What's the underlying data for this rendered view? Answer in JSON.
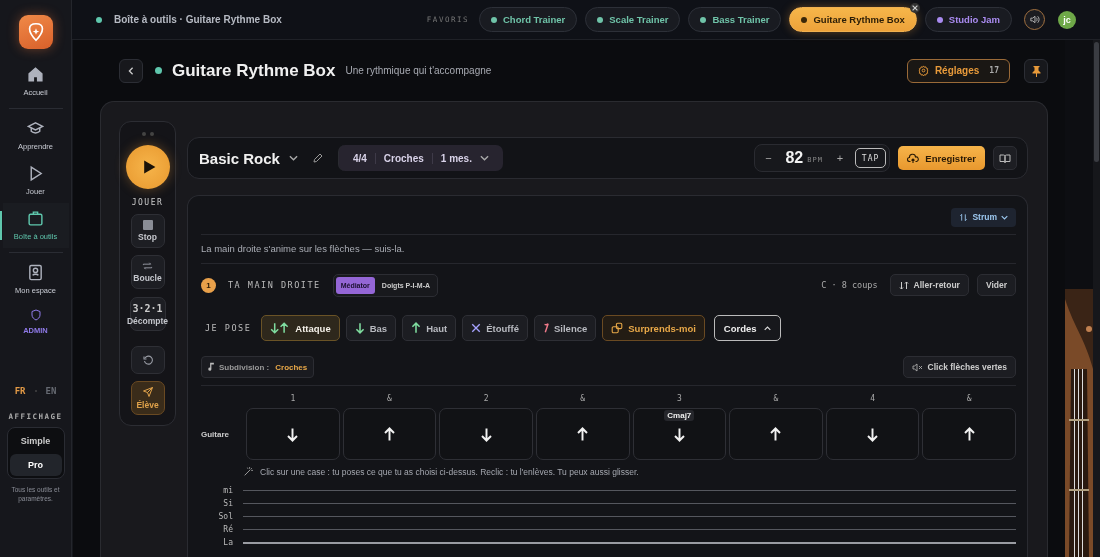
{
  "sidebar": {
    "items": [
      {
        "label": "Accueil",
        "kind": "nav",
        "selected": false
      },
      {
        "label": "Apprendre",
        "kind": "nav",
        "selected": false
      },
      {
        "label": "Jouer",
        "kind": "nav",
        "selected": false
      },
      {
        "label": "Boîte à outils",
        "kind": "nav",
        "selected": true
      },
      {
        "label": "Mon espace",
        "kind": "nav",
        "selected": false
      },
      {
        "label": "ADMIN",
        "kind": "admin",
        "selected": false
      }
    ],
    "languages": [
      {
        "label": "FR",
        "selected": true
      },
      {
        "label": "EN",
        "selected": false
      }
    ],
    "display": {
      "title": "AFFICHAGE",
      "options": [
        {
          "label": "Simple",
          "selected": false
        },
        {
          "label": "Pro",
          "selected": true
        }
      ],
      "note": "Tous les outils et paramètres."
    }
  },
  "topbar": {
    "breadcrumb": "Boîte à outils · Guitare Rythme Box",
    "favorites_label": "FAVORIS",
    "favorites": [
      {
        "label": "Chord Trainer",
        "color": "#6fc3a8",
        "selected": false
      },
      {
        "label": "Scale Trainer",
        "color": "#6fc3a8",
        "selected": false
      },
      {
        "label": "Bass Trainer",
        "color": "#6fc3a8",
        "selected": false
      },
      {
        "label": "Guitare Rythme Box",
        "color": "#3a2708",
        "selected": true
      },
      {
        "label": "Studio Jam",
        "color": "#a98bf0",
        "selected": false
      }
    ],
    "avatar": "jc"
  },
  "header": {
    "title": "Guitare Rythme Box",
    "subtitle": "Une rythmique qui t'accompagne",
    "settings": "Réglages",
    "settings_count": "17"
  },
  "transport": {
    "play_label": "JOUER",
    "buttons": [
      {
        "label": "Stop",
        "kind": "stop",
        "selected": false
      },
      {
        "label": "Boucle",
        "kind": "loop",
        "selected": false
      },
      {
        "label": "Décompte",
        "kind": "countdown",
        "counter": "3·2·1",
        "selected": false
      },
      {
        "kind": "reset",
        "selected": false
      },
      {
        "label": "Élève",
        "kind": "student",
        "selected": true
      }
    ]
  },
  "toolbar": {
    "preset": "Basic Rock",
    "meter": "4/4",
    "subdivision": "Croches",
    "measures": "1 mes.",
    "tempo": {
      "minus": "−",
      "value": "82",
      "unit": "BPM",
      "plus": "+",
      "tap": "TAP"
    },
    "record": "Enregistrer"
  },
  "pattern": {
    "mode": "Strum",
    "hint": "La main droite s'anime sur les flèches — suis-la.",
    "step": {
      "number": "1",
      "title": "TA MAIN DROITE",
      "techniques": [
        {
          "label": "Médiator",
          "selected": true
        },
        {
          "label": "Doigts P-I-M-A",
          "selected": false
        }
      ],
      "info": "C · 8 coups",
      "actions": [
        "Aller-retour",
        "Vider"
      ]
    },
    "palette": {
      "label": "JE POSE",
      "tools": [
        {
          "label": "Attaque",
          "kind": "attack",
          "selected": true
        },
        {
          "label": "Bas",
          "kind": "down",
          "selected": false
        },
        {
          "label": "Haut",
          "kind": "up",
          "selected": false
        },
        {
          "label": "Étouffé",
          "kind": "mute",
          "selected": false
        },
        {
          "label": "Silence",
          "kind": "rest",
          "selected": false
        },
        {
          "label": "Surprends-moi",
          "kind": "random",
          "selected": false
        }
      ],
      "chords": "Cordes"
    },
    "subdivision_label": "Subdivision :",
    "subdivision_value": "Croches",
    "click": "Click flèches vertes",
    "beats": [
      "1",
      "&",
      "2",
      "&",
      "3",
      "&",
      "4",
      "&"
    ],
    "row_label": "Guitare",
    "cells": [
      {
        "kind": "down"
      },
      {
        "kind": "up"
      },
      {
        "kind": "down"
      },
      {
        "kind": "up"
      },
      {
        "kind": "down",
        "chord": "Cmaj7"
      },
      {
        "kind": "up"
      },
      {
        "kind": "down"
      },
      {
        "kind": "up"
      }
    ],
    "tip": "Clic sur une case : tu poses ce que tu as choisi ci-dessus. Reclic : tu l'enlèves. Tu peux aussi glisser.",
    "strings": [
      "mi",
      "Si",
      "Sol",
      "Ré",
      "La"
    ]
  }
}
